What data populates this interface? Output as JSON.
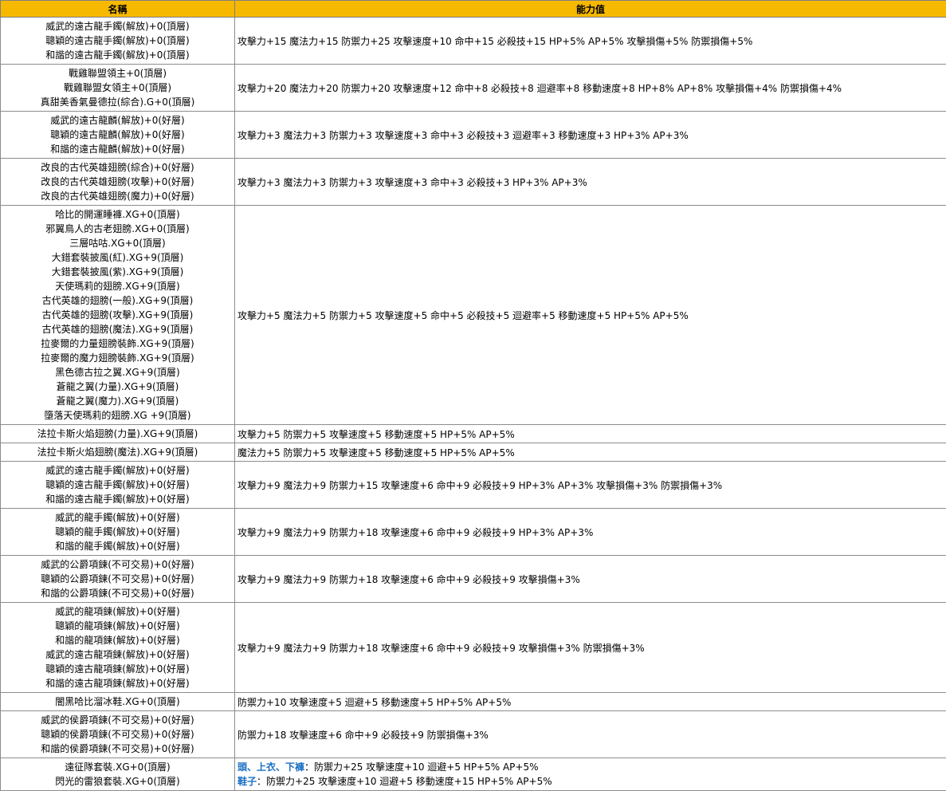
{
  "headers": {
    "name": "名稱",
    "stats": "能力值"
  },
  "rows": [
    {
      "names": [
        "威武的遠古龍手鐲(解放)+0(頂層)",
        "聰穎的遠古龍手鐲(解放)+0(頂層)",
        "和諧的遠古龍手鐲(解放)+0(頂層)"
      ],
      "stats": "攻擊力+15 魔法力+15 防禦力+25 攻擊速度+10 命中+15 必殺技+15 HP+5% AP+5% 攻擊損傷+5% 防禦損傷+5%"
    },
    {
      "names": [
        "戰雞聯盟領主+0(頂層)",
        "戰雞聯盟女領主+0(頂層)",
        "真甜美香氣曼德拉(綜合).G+0(頂層)"
      ],
      "stats": "攻擊力+20 魔法力+20 防禦力+20 攻擊速度+12 命中+8 必殺技+8 迴避率+8 移動速度+8 HP+8% AP+8% 攻擊損傷+4% 防禦損傷+4%"
    },
    {
      "names": [
        "威武的遠古龍麟(解放)+0(好層)",
        "聰穎的遠古龍麟(解放)+0(好層)",
        "和諧的遠古龍麟(解放)+0(好層)"
      ],
      "stats": "攻擊力+3 魔法力+3 防禦力+3 攻擊速度+3 命中+3 必殺技+3 迴避率+3 移動速度+3  HP+3% AP+3%"
    },
    {
      "names": [
        "改良的古代英雄翅膀(綜合)+0(好層)",
        "改良的古代英雄翅膀(攻擊)+0(好層)",
        "改良的古代英雄翅膀(魔力)+0(好層)"
      ],
      "stats": "攻擊力+3 魔法力+3 防禦力+3 攻擊速度+3 命中+3 必殺技+3 HP+3% AP+3%"
    },
    {
      "names": [
        "哈比的開運睡褲.XG+0(頂層)",
        "邪翼鳥人的古老翅膀.XG+0(頂層)",
        "三層咕咕.XG+0(頂層)",
        "大錯套裝披風(紅).XG+9(頂層)",
        "大錯套裝披風(紫).XG+9(頂層)",
        "天使瑪莉的翅膀.XG+9(頂層)",
        "古代英雄的翅膀(一般).XG+9(頂層)",
        "古代英雄的翅膀(攻擊).XG+9(頂層)",
        "古代英雄的翅膀(魔法).XG+9(頂層)",
        "拉麥爾的力量翅膀裝飾.XG+9(頂層)",
        "拉麥爾的魔力翅膀裝飾.XG+9(頂層)",
        "黑色德古拉之翼.XG+9(頂層)",
        "蒼龍之翼(力量).XG+9(頂層)",
        "蒼龍之翼(魔力).XG+9(頂層)",
        "墮落天使瑪莉的翅膀.XG +9(頂層)"
      ],
      "stats": "攻擊力+5 魔法力+5 防禦力+5 攻擊速度+5 命中+5 必殺技+5 迴避率+5 移動速度+5  HP+5% AP+5%"
    },
    {
      "names": [
        "法拉卡斯火焰翅膀(力量).XG+9(頂層)"
      ],
      "stats": "攻擊力+5 防禦力+5 攻擊速度+5 移動速度+5 HP+5% AP+5%"
    },
    {
      "names": [
        "法拉卡斯火焰翅膀(魔法).XG+9(頂層)"
      ],
      "stats": "魔法力+5 防禦力+5 攻擊速度+5 移動速度+5 HP+5% AP+5%"
    },
    {
      "names": [
        "威武的遠古龍手鐲(解放)+0(好層)",
        "聰穎的遠古龍手鐲(解放)+0(好層)",
        "和諧的遠古龍手鐲(解放)+0(好層)"
      ],
      "stats": "攻擊力+9 魔法力+9 防禦力+15 攻擊速度+6 命中+9 必殺技+9  HP+3% AP+3% 攻擊損傷+3% 防禦損傷+3%"
    },
    {
      "names": [
        "威武的龍手鐲(解放)+0(好層)",
        "聰穎的龍手鐲(解放)+0(好層)",
        "和諧的龍手鐲(解放)+0(好層)"
      ],
      "stats": "攻擊力+9 魔法力+9 防禦力+18 攻擊速度+6 命中+9 必殺技+9  HP+3% AP+3%"
    },
    {
      "names": [
        "威武的公爵項鍊(不可交易)+0(好層)",
        "聰穎的公爵項鍊(不可交易)+0(好層)",
        "和諧的公爵項鍊(不可交易)+0(好層)"
      ],
      "stats": "攻擊力+9 魔法力+9 防禦力+18 攻擊速度+6 命中+9 必殺技+9 攻擊損傷+3%"
    },
    {
      "names": [
        "威武的龍項鍊(解放)+0(好層)",
        "聰穎的龍項鍊(解放)+0(好層)",
        "和諧的龍項鍊(解放)+0(好層)",
        "威武的遠古龍項鍊(解放)+0(好層)",
        "聰穎的遠古龍項鍊(解放)+0(好層)",
        "和諧的遠古龍項鍊(解放)+0(好層)"
      ],
      "stats": "攻擊力+9 魔法力+9 防禦力+18 攻擊速度+6 命中+9 必殺技+9 攻擊損傷+3% 防禦損傷+3%"
    },
    {
      "names": [
        "闇黑哈比溜冰鞋.XG+0(頂層)"
      ],
      "stats": "防禦力+10 攻擊速度+5 迴避+5 移動速度+5 HP+5% AP+5%"
    },
    {
      "names": [
        "威武的侯爵項鍊(不可交易)+0(好層)",
        "聰穎的侯爵項鍊(不可交易)+0(好層)",
        "和諧的侯爵項鍊(不可交易)+0(好層)"
      ],
      "stats": "防禦力+18 攻擊速度+6 命中+9 必殺技+9  防禦損傷+3%"
    }
  ],
  "last_row": {
    "names": [
      "遠征隊套裝.XG+0(頂層)",
      "閃光的雷狼套裝.XG+0(頂層)"
    ],
    "line1_label": "頭、上衣、下褲",
    "line1_text": "：防禦力+25 攻擊速度+10 迴避+5 HP+5% AP+5%",
    "line2_label": "鞋子",
    "line2_text": "：防禦力+25 攻擊速度+10 迴避+5 移動速度+15 HP+5% AP+5%"
  },
  "colors": {
    "header_bg": "#f6b900",
    "highlight": "#1a6fc4",
    "border": "#8c8c8c"
  }
}
